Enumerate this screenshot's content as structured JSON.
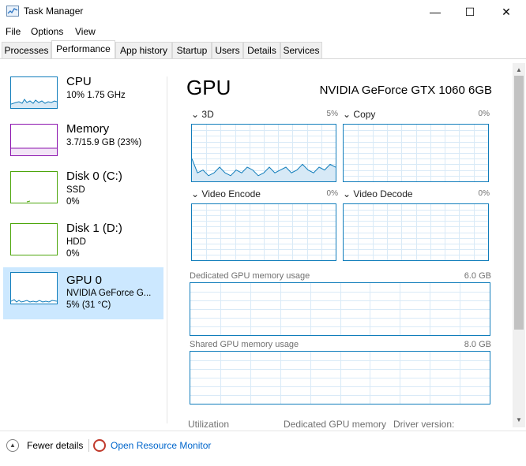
{
  "window": {
    "title": "Task Manager",
    "controls": {
      "minimize": "—",
      "maximize": "☐",
      "close": "✕"
    }
  },
  "menu": [
    "File",
    "Options",
    "View"
  ],
  "tabs": [
    "Processes",
    "Performance",
    "App history",
    "Startup",
    "Users",
    "Details",
    "Services"
  ],
  "active_tab": "Performance",
  "sidebar": {
    "items": [
      {
        "name": "CPU",
        "line1": "10% 1.75 GHz",
        "line2": "",
        "color": "#117dbb"
      },
      {
        "name": "Memory",
        "line1": "3.7/15.9 GB (23%)",
        "line2": "",
        "color": "#8b12ae"
      },
      {
        "name": "Disk 0 (C:)",
        "line1": "SSD",
        "line2": "0%",
        "color": "#4da60c"
      },
      {
        "name": "Disk 1 (D:)",
        "line1": "HDD",
        "line2": "0%",
        "color": "#4da60c"
      },
      {
        "name": "GPU 0",
        "line1": "NVIDIA GeForce G...",
        "line2": "5% (31 °C)",
        "color": "#117dbb"
      }
    ],
    "selected_index": 4
  },
  "main": {
    "heading": "GPU",
    "model": "NVIDIA GeForce GTX 1060 6GB",
    "engines": [
      {
        "label": "3D",
        "percent": "5%"
      },
      {
        "label": "Copy",
        "percent": "0%"
      },
      {
        "label": "Video Encode",
        "percent": "0%"
      },
      {
        "label": "Video Decode",
        "percent": "0%"
      }
    ],
    "dedicated_memory": {
      "label": "Dedicated GPU memory usage",
      "value": "6.0 GB"
    },
    "shared_memory": {
      "label": "Shared GPU memory usage",
      "value": "8.0 GB"
    },
    "stats": {
      "utilization": "Utilization",
      "dedicated": "Dedicated GPU memory",
      "driver": "Driver version:"
    },
    "graph_color": "#117dbb",
    "grid_color": "#d9eaf7"
  },
  "bottom": {
    "fewer_details": "Fewer details",
    "open_resource_monitor": "Open Resource Monitor"
  }
}
